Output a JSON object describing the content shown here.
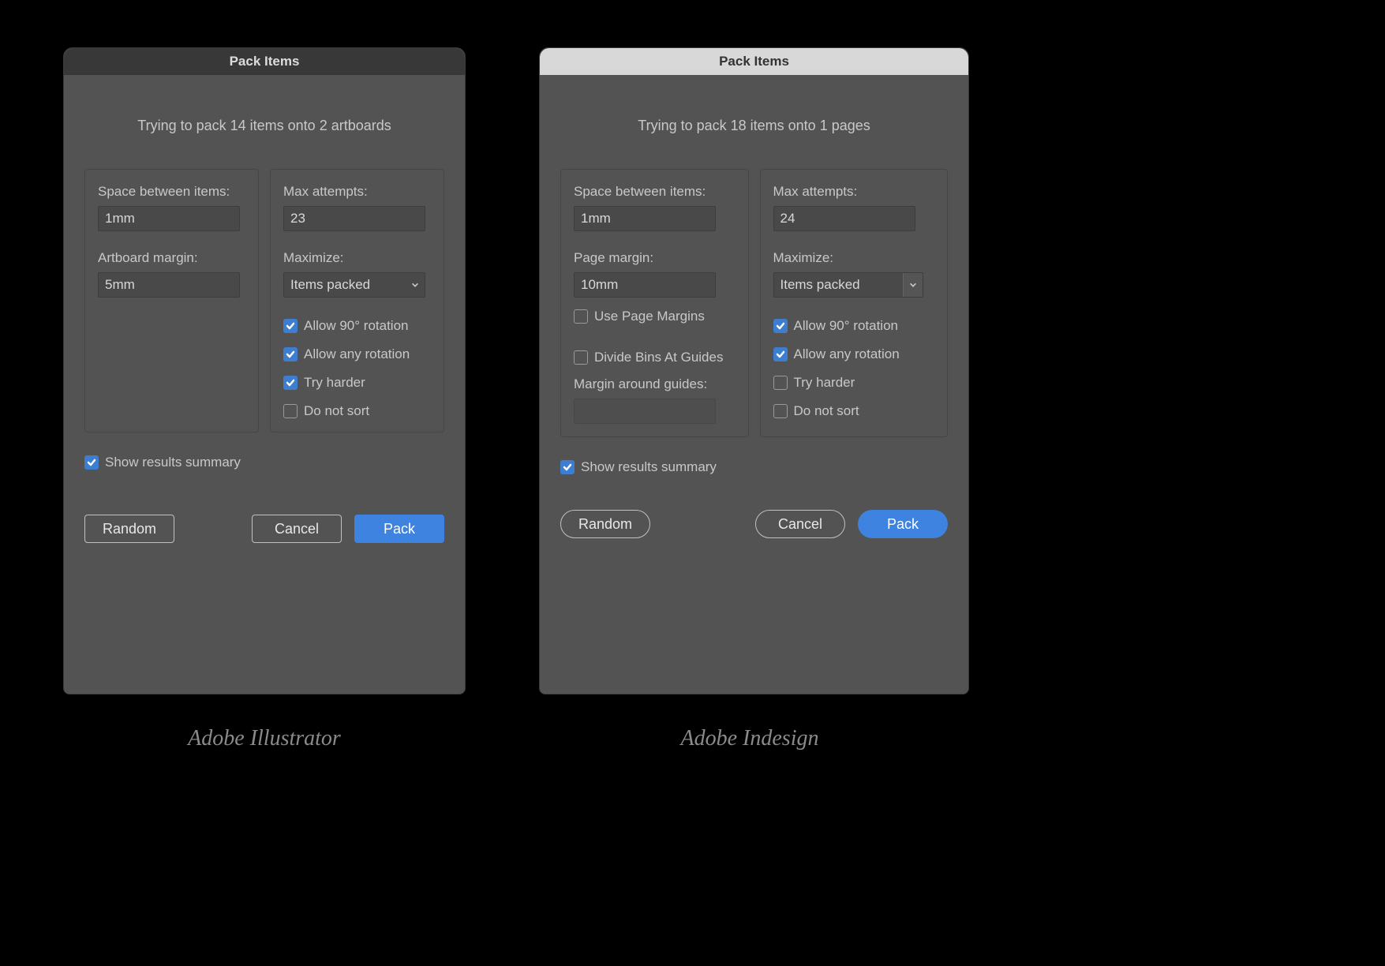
{
  "illustrator": {
    "title": "Pack Items",
    "subtitle": "Trying to pack 14 items onto 2 artboards",
    "left": {
      "space_label": "Space between items:",
      "space_value": "1mm",
      "margin_label": "Artboard margin:",
      "margin_value": "5mm"
    },
    "right": {
      "attempts_label": "Max attempts:",
      "attempts_value": "23",
      "maximize_label": "Maximize:",
      "maximize_value": "Items packed",
      "allow90_label": "Allow 90° rotation",
      "allowany_label": "Allow any rotation",
      "tryharder_label": "Try harder",
      "donotsort_label": "Do not sort",
      "allow90_checked": true,
      "allowany_checked": true,
      "tryharder_checked": true,
      "donotsort_checked": false
    },
    "show_summary_label": "Show results summary",
    "show_summary_checked": true,
    "buttons": {
      "random": "Random",
      "cancel": "Cancel",
      "pack": "Pack"
    },
    "caption": "Adobe Illustrator"
  },
  "indesign": {
    "title": "Pack Items",
    "subtitle": "Trying to pack 18 items onto 1 pages",
    "left": {
      "space_label": "Space between items:",
      "space_value": "1mm",
      "margin_label": "Page margin:",
      "margin_value": "10mm",
      "use_page_margins_label": "Use Page Margins",
      "use_page_margins_checked": false,
      "divide_bins_label": "Divide Bins At Guides",
      "divide_bins_checked": false,
      "margin_guides_label": "Margin around guides:",
      "margin_guides_value": ""
    },
    "right": {
      "attempts_label": "Max attempts:",
      "attempts_value": "24",
      "maximize_label": "Maximize:",
      "maximize_value": "Items packed",
      "allow90_label": "Allow 90° rotation",
      "allowany_label": "Allow any rotation",
      "tryharder_label": "Try harder",
      "donotsort_label": "Do not sort",
      "allow90_checked": true,
      "allowany_checked": true,
      "tryharder_checked": false,
      "donotsort_checked": false
    },
    "show_summary_label": "Show results summary",
    "show_summary_checked": true,
    "buttons": {
      "random": "Random",
      "cancel": "Cancel",
      "pack": "Pack"
    },
    "caption": "Adobe Indesign"
  }
}
